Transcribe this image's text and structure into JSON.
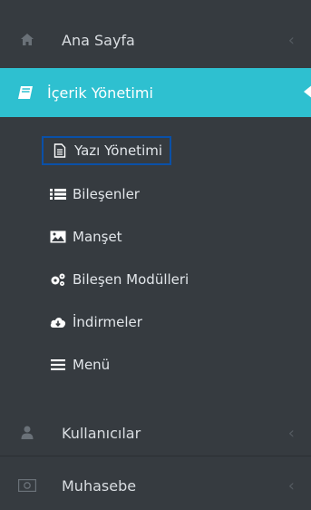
{
  "sidebar": {
    "home": {
      "label": "Ana Sayfa",
      "icon": "home-icon"
    },
    "content": {
      "label": "İçerik Yönetimi",
      "icon": "book-icon"
    },
    "submenu": [
      {
        "label": "Yazı Yönetimi",
        "icon": "document-icon",
        "selected": true
      },
      {
        "label": "Bileşenler",
        "icon": "list-icon"
      },
      {
        "label": "Manşet",
        "icon": "image-icon"
      },
      {
        "label": "Bileşen Modülleri",
        "icon": "gears-icon"
      },
      {
        "label": "İndirmeler",
        "icon": "cloud-download-icon"
      },
      {
        "label": "Menü",
        "icon": "menu-icon"
      }
    ],
    "users": {
      "label": "Kullanıcılar",
      "icon": "users-icon"
    },
    "accounting": {
      "label": "Muhasebe",
      "icon": "money-icon"
    }
  },
  "colors": {
    "sidebar_bg": "#363b40",
    "active_bg": "#2ec0d0",
    "selected_border": "#0a50a8"
  }
}
